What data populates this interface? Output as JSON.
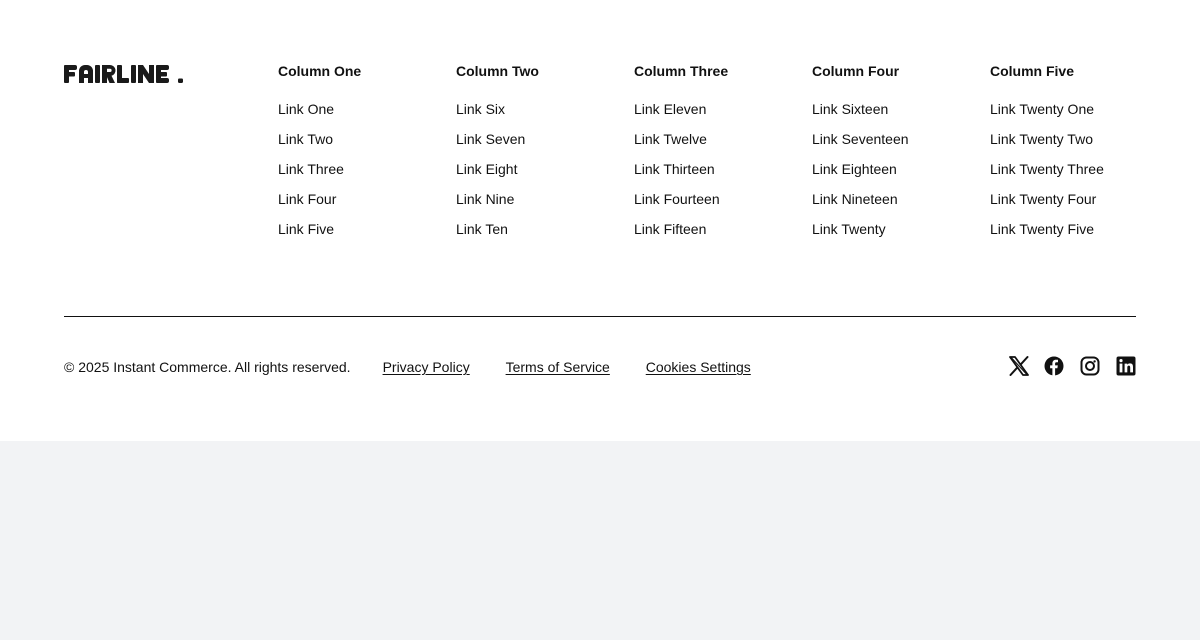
{
  "brand": {
    "name": "FAIRLINE."
  },
  "columns": [
    {
      "title": "Column One",
      "links": [
        "Link One",
        "Link Two",
        "Link Three",
        "Link Four",
        "Link Five"
      ]
    },
    {
      "title": "Column Two",
      "links": [
        "Link Six",
        "Link Seven",
        "Link Eight",
        "Link Nine",
        "Link Ten"
      ]
    },
    {
      "title": "Column Three",
      "links": [
        "Link Eleven",
        "Link Twelve",
        "Link Thirteen",
        "Link Fourteen",
        "Link Fifteen"
      ]
    },
    {
      "title": "Column Four",
      "links": [
        "Link Sixteen",
        "Link Seventeen",
        "Link Eighteen",
        "Link Nineteen",
        "Link Twenty"
      ]
    },
    {
      "title": "Column Five",
      "links": [
        "Link Twenty One",
        "Link Twenty Two",
        "Link Twenty Three",
        "Link Twenty Four",
        "Link Twenty Five"
      ]
    }
  ],
  "bottom": {
    "copyright": "© 2025 Instant Commerce. All rights reserved.",
    "legal_links": [
      "Privacy Policy",
      "Terms of Service",
      "Cookies Settings"
    ]
  },
  "socials": [
    "x-icon",
    "facebook-icon",
    "instagram-icon",
    "linkedin-icon"
  ],
  "colors": {
    "text": "#111111",
    "footer_bg": "#ffffff",
    "page_bg": "#f2f3f5"
  }
}
